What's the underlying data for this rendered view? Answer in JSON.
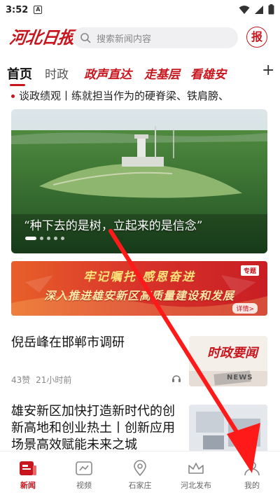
{
  "status_bar": {
    "time": "3:52",
    "a_icon": "A"
  },
  "header": {
    "logo": "河北日报",
    "search_placeholder": "搜索新闻内容",
    "bao_badge": "报"
  },
  "tabs": [
    {
      "label": "首页",
      "active": true
    },
    {
      "label": "时政"
    },
    {
      "label": "政声直达",
      "special": true
    },
    {
      "label": "走基层",
      "special": true
    },
    {
      "label": "看雄安",
      "special": true
    }
  ],
  "ticker": "谈政绩观丨练就担当作为的硬脊梁、铁肩膀、",
  "hero": {
    "caption": "“种下去的是树，立起来的是信念”",
    "slide_index": 1,
    "slide_count": 5
  },
  "special_banner": {
    "line1": "牢记嘱托  感恩奋进",
    "line2": "深入推进雄安新区高质量建设和发展",
    "tag": "专题",
    "more": "详情>"
  },
  "news": [
    {
      "title": "倪岳峰在邯郸市调研",
      "likes": "43赞",
      "time": "21小时前",
      "thumb_label": "时政要闻",
      "thumb_sub": "NEWS"
    },
    {
      "title": "雄安新区加快打造新时代的创新高地和创业热土丨创新应用场景高效赋能未来之城"
    }
  ],
  "bottom_nav": [
    {
      "label": "新闻",
      "icon": "news-icon",
      "active": true
    },
    {
      "label": "视频",
      "icon": "video-icon"
    },
    {
      "label": "石家庄",
      "icon": "location-icon"
    },
    {
      "label": "河北发布",
      "icon": "crown-icon"
    },
    {
      "label": "我的",
      "icon": "user-icon"
    }
  ],
  "colors": {
    "brand_red": "#c8161e",
    "ticker_dot": "#c8161e"
  }
}
